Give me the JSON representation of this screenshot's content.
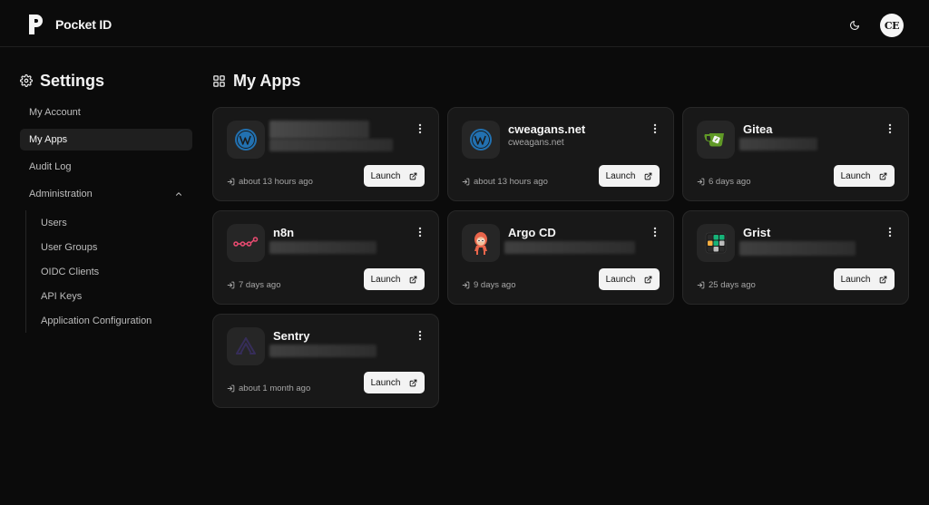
{
  "header": {
    "brand": "Pocket ID",
    "avatar_initials": "CE"
  },
  "sidebar": {
    "title": "Settings",
    "items": [
      {
        "label": "My Account"
      },
      {
        "label": "My Apps",
        "active": true
      },
      {
        "label": "Audit Log"
      }
    ],
    "admin": {
      "label": "Administration",
      "items": [
        {
          "label": "Users"
        },
        {
          "label": "User Groups"
        },
        {
          "label": "OIDC Clients"
        },
        {
          "label": "API Keys"
        },
        {
          "label": "Application Configuration"
        }
      ]
    }
  },
  "main": {
    "title": "My Apps",
    "launch_label": "Launch",
    "apps": [
      {
        "name": "",
        "url": "",
        "last_used": "about 13 hours ago",
        "icon": "wordpress-icon"
      },
      {
        "name": "cweagans.net",
        "url": "cweagans.net",
        "last_used": "about 13 hours ago",
        "icon": "wordpress-icon"
      },
      {
        "name": "Gitea",
        "url": "",
        "last_used": "6 days ago",
        "icon": "gitea-icon"
      },
      {
        "name": "n8n",
        "url": "",
        "last_used": "7 days ago",
        "icon": "n8n-icon"
      },
      {
        "name": "Argo CD",
        "url": "",
        "last_used": "9 days ago",
        "icon": "argocd-icon"
      },
      {
        "name": "Grist",
        "url": "",
        "last_used": "25 days ago",
        "icon": "grist-icon"
      },
      {
        "name": "Sentry",
        "url": "",
        "last_used": "about 1 month ago",
        "icon": "sentry-icon"
      }
    ]
  },
  "colors": {
    "background": "#0b0b0b",
    "card": "#181818",
    "card_border": "#282828",
    "launch_bg": "#f3f3f3",
    "wordpress": "#2271b1",
    "gitea": "#609926",
    "n8n": "#ea4b71",
    "sentry": "#362d59"
  }
}
